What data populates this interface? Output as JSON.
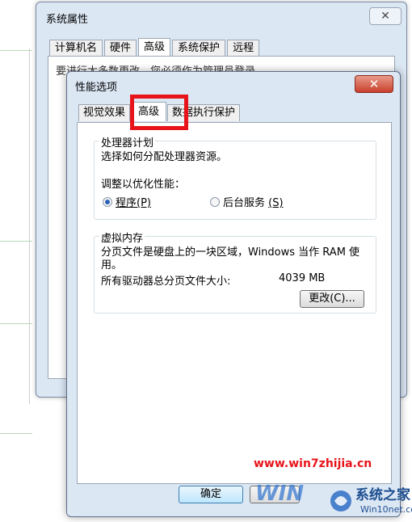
{
  "back_window": {
    "title": "系统属性",
    "close_glyph": "✕",
    "tabs": [
      "计算机名",
      "硬件",
      "高级",
      "系统保护",
      "远程"
    ],
    "partial_text": "要进行大多数更改，您必须作为管理员登录"
  },
  "dialog": {
    "title": "性能选项",
    "close_glyph": "✕",
    "tabs": [
      "视觉效果",
      "高级",
      "数据执行保护"
    ],
    "processor": {
      "group_title": "处理器计划",
      "description": "选择如何分配处理器资源。",
      "optimize_label": "调整以优化性能：",
      "option_programs": "程序",
      "option_programs_key": "(P)",
      "option_services": "后台服务",
      "option_services_key": "(S)",
      "selected": "programs"
    },
    "virtual_memory": {
      "group_title": "虚拟内存",
      "description_line1": "分页文件是硬盘上的一块区域，Windows 当作 RAM 使",
      "description_line2": "用。",
      "total_label": "所有驱动器总分页文件大小:",
      "total_value": "4039 MB",
      "change_button": "更改(C)..."
    },
    "ok_button": "确定"
  },
  "watermark": {
    "url": "www.win7zhijia.cn",
    "site_name": "系统之家",
    "site_url": "Win10net.com",
    "w_letters": "WIN"
  },
  "colors": {
    "highlight": "#e8141b",
    "titlebar": "#dce7f4",
    "close_red": "#c8402c"
  }
}
